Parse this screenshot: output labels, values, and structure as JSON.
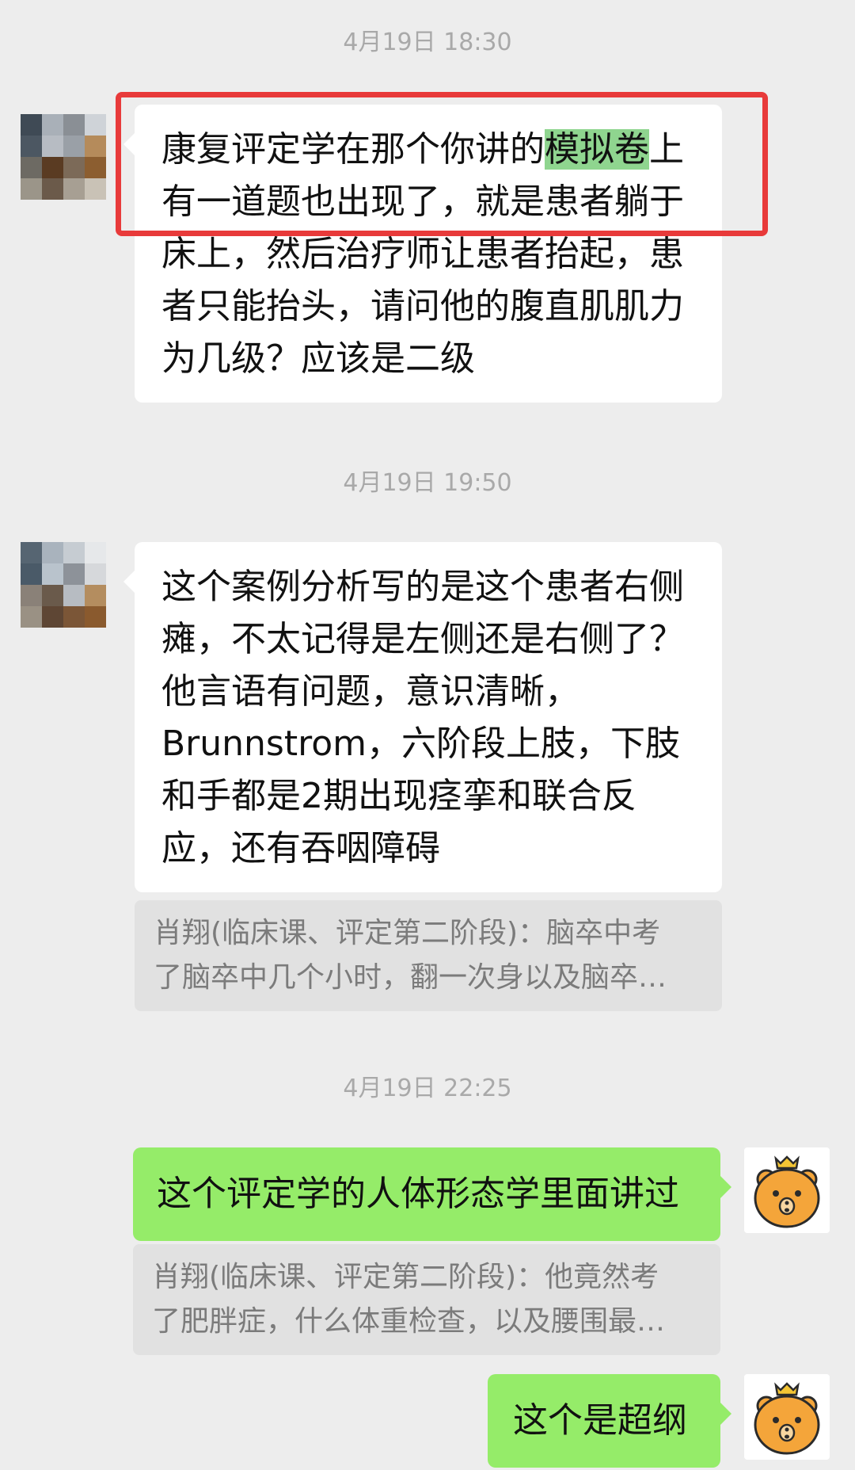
{
  "messages": [
    {
      "timestamp": "4月19日 18:30",
      "text_before": "康复评定学在那个你讲的",
      "highlight": "模拟卷",
      "text_after": "上有一道题也出现了，就是患者躺于床上，然后治疗师让患者抬起，患者只能抬头，请问他的腹直肌肌力为几级？应该是二级"
    },
    {
      "timestamp": "4月19日 19:50",
      "text": "这个案例分析写的是这个患者右侧瘫，不太记得是左侧还是右侧了？他言语有问题，意识清晰，Brunnstrom，六阶段上肢，下肢和手都是2期出现痉挛和联合反应，还有吞咽障碍",
      "quote_line1": "肖翔(临床课、评定第二阶段)：脑卒中考",
      "quote_line2": "了脑卒中几个小时，翻一次身以及脑卒…"
    },
    {
      "timestamp": "4月19日 22:25",
      "text": "这个评定学的人体形态学里面讲过",
      "quote_line1": "肖翔(临床课、评定第二阶段)：他竟然考",
      "quote_line2": "了肥胖症，什么体重检查，以及腰围最…"
    },
    {
      "text": "这个是超纲"
    }
  ],
  "colors": {
    "background": "#ededed",
    "incoming_bubble": "#ffffff",
    "outgoing_bubble": "#95ec69",
    "highlight": "#8fd58f",
    "annotation_box": "#e83a3a"
  },
  "avatars": {
    "contact": "pixelated-avatar",
    "self": "bear-emoji-avatar"
  }
}
